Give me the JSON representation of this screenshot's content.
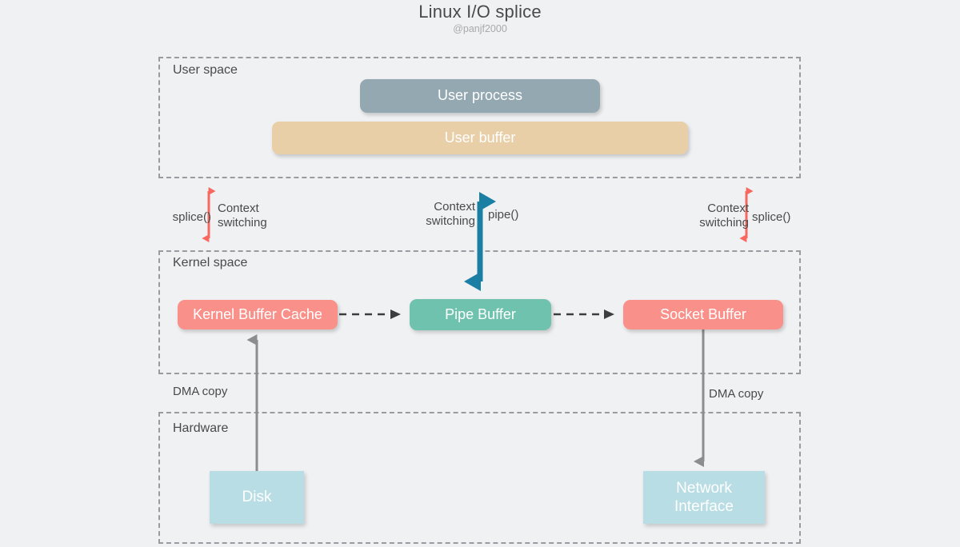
{
  "header": {
    "title": "Linux I/O splice",
    "subtitle": "@panjf2000"
  },
  "regions": [
    {
      "id": "user",
      "label": "User space"
    },
    {
      "id": "kernel",
      "label": "Kernel space"
    },
    {
      "id": "hardware",
      "label": "Hardware"
    }
  ],
  "boxes": {
    "user_process": {
      "label": "User process",
      "color": "#93a8b1"
    },
    "user_buffer": {
      "label": "User buffer",
      "color": "#e8cfa8"
    },
    "kernel_cache": {
      "label": "Kernel Buffer Cache",
      "color": "#f9918a"
    },
    "pipe_buffer": {
      "label": "Pipe Buffer",
      "color": "#6fc3ae"
    },
    "socket_buffer": {
      "label": "Socket Buffer",
      "color": "#f9918a"
    },
    "disk": {
      "label": "Disk",
      "color": "#b9dde4"
    },
    "network_interface": {
      "label": "Network\nInterface",
      "color": "#b9dde4"
    }
  },
  "labels": {
    "splice_left": "splice()",
    "context_switch_left": "Context\nswitching",
    "context_switch_mid": "Context\nswitching",
    "pipe_call": "pipe()",
    "context_switch_right": "Context\nswitching",
    "splice_right": "splice()",
    "dma_copy_left": "DMA copy",
    "dma_copy_right": "DMA copy"
  },
  "colors": {
    "background": "#f0f1f3",
    "region_border": "#9a9ba0",
    "arrow_red": "#f8685e",
    "arrow_teal": "#1b7fa4",
    "arrow_gray": "#8d8d8d",
    "arrow_dashed": "#3d3d3d",
    "text": "#4a4a4a"
  }
}
